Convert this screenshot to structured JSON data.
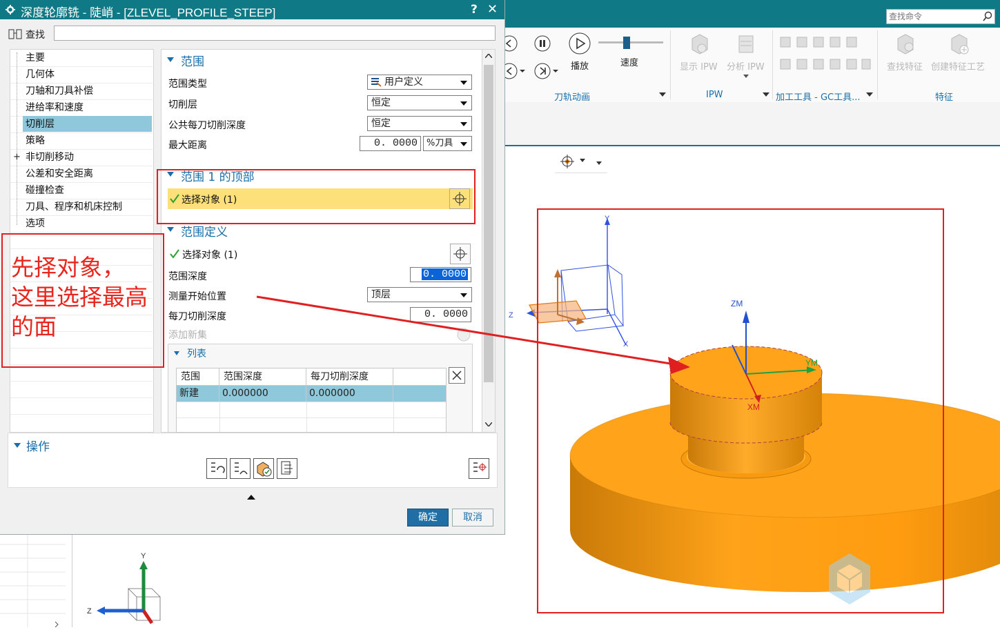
{
  "dialog": {
    "title": "深度轮廓铣 - 陡峭 - [ZLEVEL_PROFILE_STEEP]",
    "help": "?",
    "close": "✕",
    "search_label": "查找",
    "search_value": ""
  },
  "tree": {
    "items": [
      "主要",
      "几何体",
      "刀轴和刀具补偿",
      "进给率和速度",
      "切削层",
      "策略",
      "非切削移动",
      "公差和安全距离",
      "碰撞检查",
      "刀具、程序和机床控制",
      "选项"
    ],
    "selected": "切削层",
    "expandable_marker": "+"
  },
  "range_section": {
    "title": "范围",
    "range_type_label": "范围类型",
    "range_type_value": "用户定义",
    "cut_layer_label": "切削层",
    "cut_layer_value": "恒定",
    "common_depth_label": "公共每刀切削深度",
    "common_depth_value": "恒定",
    "max_distance_label": "最大距离",
    "max_distance_value": "0. 0000",
    "max_distance_unit": "%刀具"
  },
  "range1_top_section": {
    "title": "范围 1 的顶部",
    "select_label": "选择对象 (1)"
  },
  "range_def_section": {
    "title": "范围定义",
    "select_label": "选择对象 (1)",
    "depth_label": "范围深度",
    "depth_value": "0. 0000",
    "measure_label": "测量开始位置",
    "measure_value": "顶层",
    "cut_depth_label": "每刀切削深度",
    "cut_depth_value": "0. 0000",
    "add_set_label": "添加新集"
  },
  "list_section": {
    "title": "列表",
    "columns": [
      "范围",
      "范围深度",
      "每刀切削深度"
    ],
    "rows": [
      [
        "新建",
        "0.000000",
        "0.000000"
      ]
    ]
  },
  "ops_section": {
    "title": "操作"
  },
  "buttons": {
    "ok": "确定",
    "cancel": "取消"
  },
  "annotation": {
    "text_line1": "先择对象，",
    "text_line2": "这里选择最高",
    "text_line3": "的面"
  },
  "ribbon": {
    "search_placeholder": "查找命令",
    "play_label": "播放",
    "speed_label": "速度",
    "show_ipw": "显示 IPW",
    "analyze_ipw": "分析 IPW",
    "find_feature": "查找特征",
    "create_feature_process": "创建特征工艺",
    "group_toolpath_anim": "刀轨动画",
    "group_ipw": "IPW",
    "group_machining_tools": "加工工具 - GC工具...",
    "group_feature": "特征"
  },
  "viewport": {
    "triad_labels": {
      "y": "Y",
      "z": "Z",
      "x": "X",
      "zm": "ZM",
      "ym": "YM",
      "xm": "XM"
    }
  },
  "colors": {
    "titlebar": "#0f7a86",
    "accent_blue": "#1a6fa8",
    "selection_yellow": "#fde07a",
    "annotation_red": "#e02020",
    "part_orange": "#ffa31a"
  }
}
